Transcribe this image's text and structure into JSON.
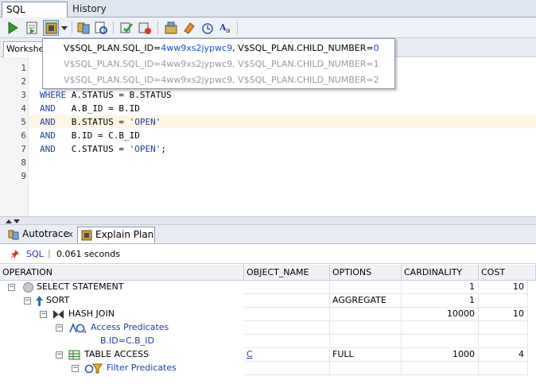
{
  "tabs": {
    "sql_worksheet": "SQL Worksheet",
    "history": "History"
  },
  "subtab": {
    "label": "Worksheet"
  },
  "editor": {
    "line_numbers": [
      "1",
      "2",
      "3",
      "4",
      "5",
      "6",
      "7",
      "8",
      "9"
    ],
    "lines": [
      {
        "kw": "WHERE",
        "rest": " A.STATUS = B.STATUS",
        "str": "",
        "tail": ""
      },
      {
        "kw": "AND",
        "rest": "   A.B_ID = B.ID",
        "str": "",
        "tail": ""
      },
      {
        "kw": "AND",
        "rest": "   B.STATUS = ",
        "str": "'OPEN'",
        "tail": ""
      },
      {
        "kw": "AND",
        "rest": "   B.ID = C.B_ID",
        "str": "",
        "tail": ""
      },
      {
        "kw": "AND",
        "rest": "   C.STATUS = ",
        "str": "'OPEN'",
        "tail": ";"
      }
    ]
  },
  "popup": {
    "items": [
      {
        "prefix": "V$SQL_PLAN.SQL_ID=",
        "id": "4ww9xs2jypwc9",
        "suffix": ", V$SQL_PLAN.CHILD_NUMBER=",
        "num": "0"
      },
      {
        "prefix": "V$SQL_PLAN.SQL_ID=",
        "id": "4ww9xs2jypwc9",
        "suffix": ", V$SQL_PLAN.CHILD_NUMBER=",
        "num": "1"
      },
      {
        "prefix": "V$SQL_PLAN.SQL_ID=",
        "id": "4ww9xs2jypwc9",
        "suffix": ", V$SQL_PLAN.CHILD_NUMBER=",
        "num": "2"
      }
    ]
  },
  "bottom_tabs": {
    "autotrace": "Autotrace",
    "explain_plan": "Explain Plan",
    "close": "x"
  },
  "info": {
    "sql_label": "SQL",
    "separator": "|",
    "elapsed": "0.061 seconds"
  },
  "grid": {
    "headers": [
      "OPERATION",
      "OBJECT_NAME",
      "OPTIONS",
      "CARDINALITY",
      "COST"
    ],
    "rows": [
      {
        "operation": "SELECT STATEMENT",
        "object": "",
        "options": "",
        "cardinality": "1",
        "cost": "10"
      },
      {
        "operation": "SORT",
        "object": "",
        "options": "AGGREGATE",
        "cardinality": "1",
        "cost": ""
      },
      {
        "operation": "HASH JOIN",
        "object": "",
        "options": "",
        "cardinality": "10000",
        "cost": "10"
      },
      {
        "operation": "Access Predicates",
        "object": "",
        "options": "",
        "cardinality": "",
        "cost": ""
      },
      {
        "operation": "B.ID=C.B_ID",
        "object": "",
        "options": "",
        "cardinality": "",
        "cost": ""
      },
      {
        "operation": "TABLE ACCESS",
        "object": "C",
        "options": "FULL",
        "cardinality": "1000",
        "cost": "4"
      },
      {
        "operation": "Filter Predicates",
        "object": "",
        "options": "",
        "cardinality": "",
        "cost": ""
      }
    ]
  },
  "colors": {
    "keyword": "#1f3fa0",
    "link": "#1f3fa0",
    "highlight_line": "#fdf6e3"
  }
}
